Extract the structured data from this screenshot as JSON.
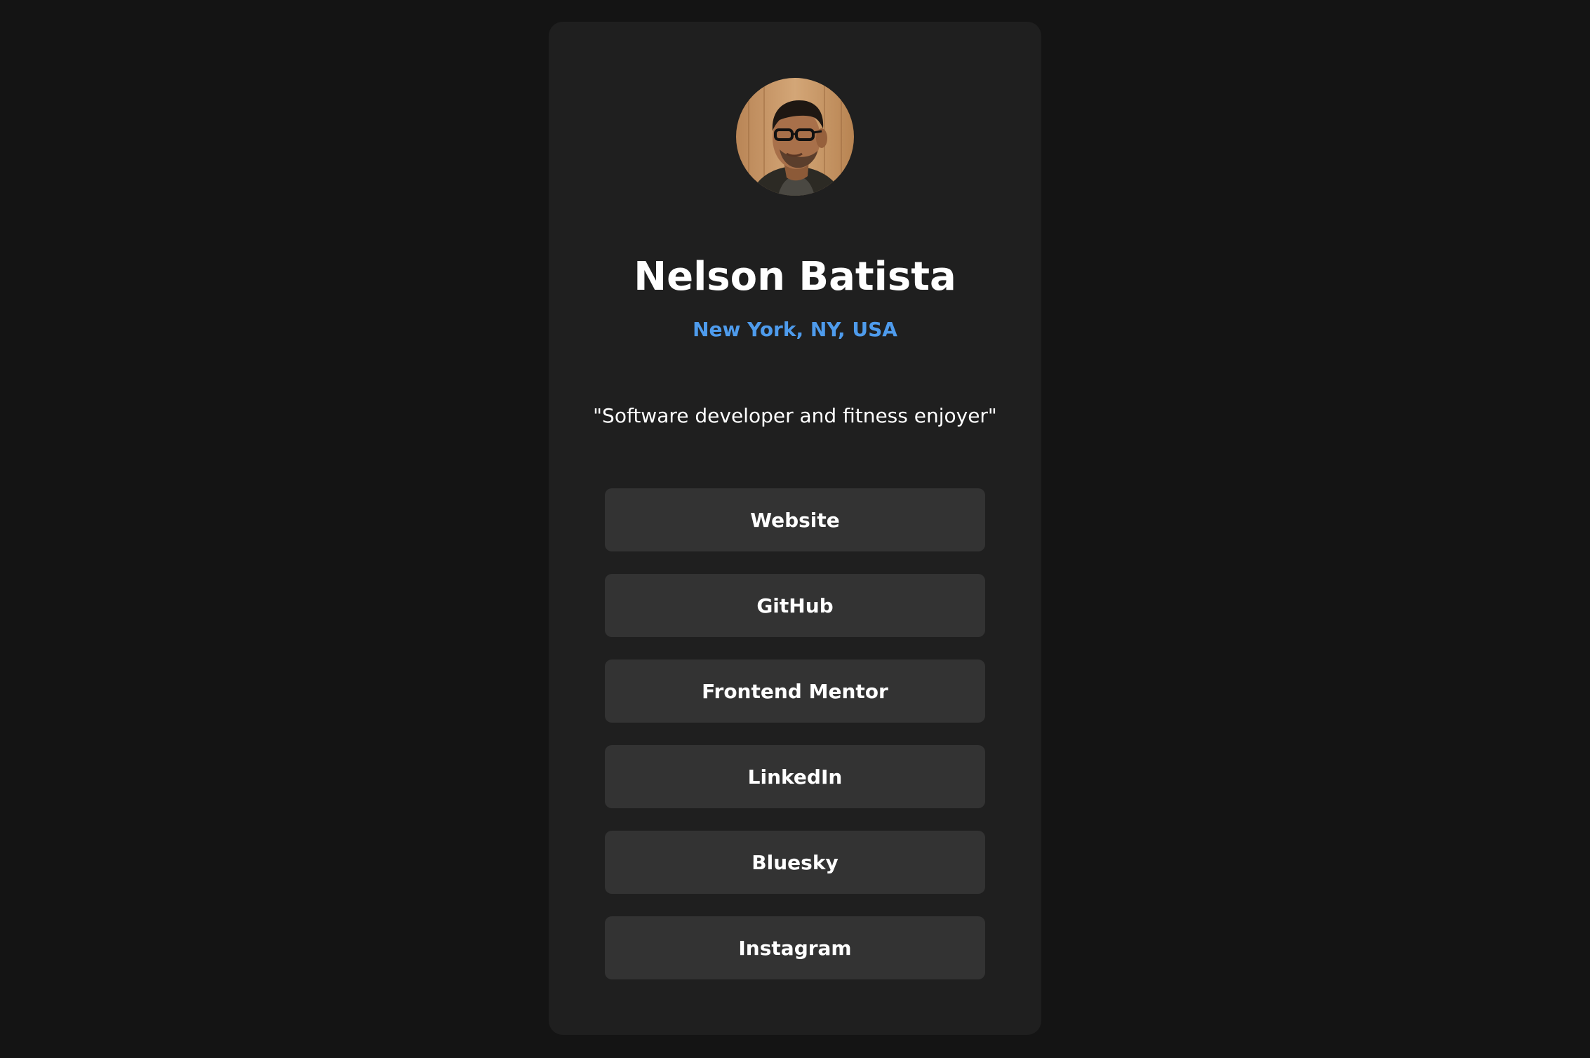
{
  "profile": {
    "name": "Nelson Batista",
    "location": "New York, NY, USA",
    "bio": "\"Software developer and fitness enjoyer\""
  },
  "links": [
    {
      "label": "Website"
    },
    {
      "label": "GitHub"
    },
    {
      "label": "Frontend Mentor"
    },
    {
      "label": "LinkedIn"
    },
    {
      "label": "Bluesky"
    },
    {
      "label": "Instagram"
    }
  ],
  "colors": {
    "page_background": "#141414",
    "card_background": "#1f1f1f",
    "button_background": "#333333",
    "accent": "#4e9bec",
    "text": "#ffffff"
  }
}
